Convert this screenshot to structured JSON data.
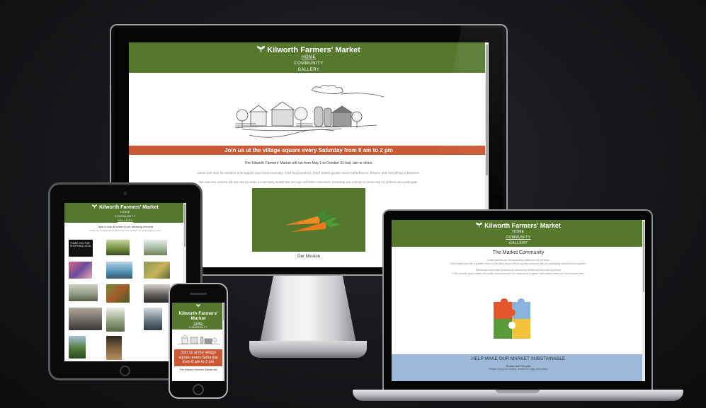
{
  "site": {
    "brand": "Kilworth Farmers' Market",
    "nav": [
      "HOME",
      "COMMUNITY",
      "GALLERY"
    ]
  },
  "desktop": {
    "banner": "Join us at the village square every Saturday from 8 am to 2 pm",
    "schedule": "The Kilworth Farmers' Market will run from May 1 to October 31 hail, rain or shine.",
    "intro": "Come join over 30 vendors and support your local economy. Find local produce, fresh baked goods, hand crafted items, flowers and everything in between.",
    "community": "We welcome vendors old and new to curate a community market that we hope will foster connection, friendship and a sense of community for all those who participate.",
    "mission_title": "Our Mission"
  },
  "laptop": {
    "title": "The Market Community",
    "p1a": "Local markets are crucial selling outlets for our vendors.",
    "p1b": "Direct sales provide a greater return to the farm labour efforts as they compete with an expanding industrial food system.",
    "p2a": "Distribution and trade products by community health and the local economy.",
    "p2b": "They provide opportunities for social connection and for consumers to gather and related where our food comes from.",
    "sustain_title": "HELP MAKE OUR MARKET SUBSTAINABLE",
    "sustain_sub": "Reuse and Recycle",
    "sustain_text": "Please bring your reusing, containers, bags and cutlery"
  },
  "tablet": {
    "caption": "Take a look at some of our amazing vendors",
    "sub": "Check out a sneak behind the scenes look at what our vendors have to offer",
    "photo_text": "THANK YOU FOR SHOPPING LOCAL"
  },
  "phone": {
    "banner": "Join us at the village square every Saturday from 8 am to 2 pm",
    "text": "The Kilworth Farmers' Market will"
  },
  "colors": {
    "header_green": "#55782d",
    "banner_orange": "#c95a35",
    "sustain_blue": "#9db8d8"
  },
  "icons": [
    "sprout-icon",
    "barn-illustration",
    "carrot-illustration",
    "puzzle-illustration"
  ]
}
